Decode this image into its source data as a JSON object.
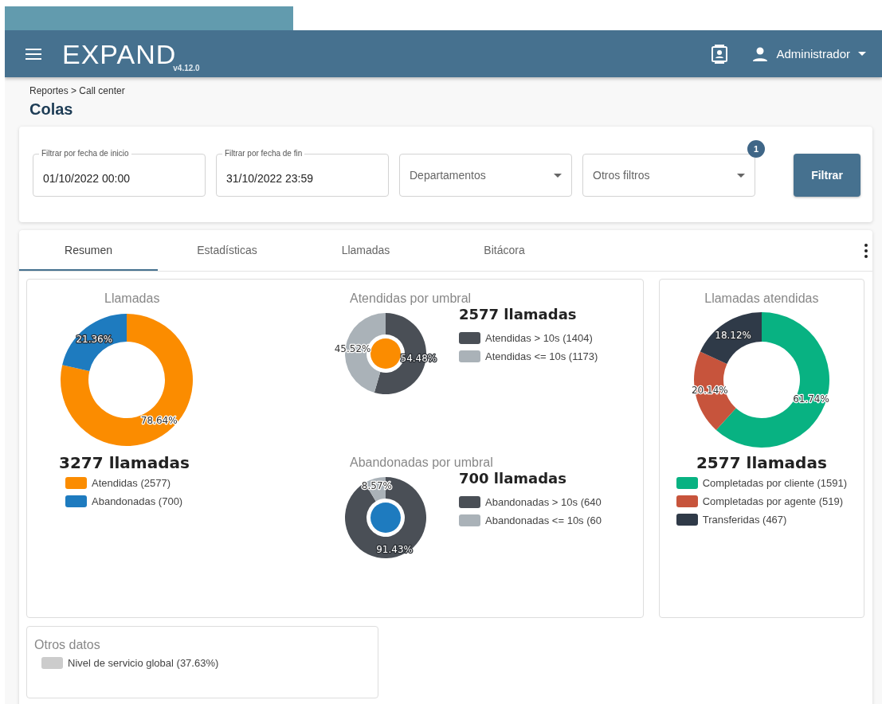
{
  "header": {
    "logo": "EXPAND",
    "version": "v4.12.0",
    "user": "Administrador"
  },
  "breadcrumb": "Reportes > Call center",
  "title": "Colas",
  "filters": [
    {
      "kind": "date",
      "label": "Filtrar por fecha de inicio",
      "value": "01/10/2022 00:00"
    },
    {
      "kind": "date",
      "label": "Filtrar por fecha de fin",
      "value": "31/10/2022 23:59"
    },
    {
      "kind": "select",
      "placeholder": "Departamentos"
    },
    {
      "kind": "select",
      "placeholder": "Otros filtros",
      "badge": "1"
    }
  ],
  "filter_button": "Filtrar",
  "tabs": [
    {
      "label": "Resumen",
      "selected": true
    },
    {
      "label": "Estadísticas",
      "selected": false
    },
    {
      "label": "Llamadas",
      "selected": false
    },
    {
      "label": "Bitácora",
      "selected": false
    }
  ],
  "llamadas": {
    "total": "3277 llamadas",
    "legend": [
      {
        "color": "#fb8c00"
      },
      {
        "color": "#1e7bbf"
      }
    ],
    "chart_data": {
      "type": "donut",
      "title": "Llamadas",
      "categories": [
        "Atendidas (2577)",
        "Abandonadas (700)"
      ],
      "values": [
        78.64,
        21.36
      ],
      "value_labels": [
        "78.64%",
        "21.36%"
      ]
    }
  },
  "thresholds": [
    {
      "total": "2577 llamadas",
      "color": "#fb8c00",
      "legend": [
        {
          "color": "#4a4f56"
        },
        {
          "color": "#aab2b8"
        }
      ],
      "chart_data": {
        "type": "donut",
        "title": "Atendidas por umbral",
        "categories": [
          "Atendidas > 10s (1404)",
          "Atendidas <= 10s (1173)"
        ],
        "values": [
          54.48,
          45.52
        ],
        "value_labels": [
          "54.48%",
          "45.52%"
        ]
      }
    },
    {
      "total": "700 llamadas",
      "color": "#1e7bbf",
      "legend": [
        {
          "color": "#4a4f56"
        },
        {
          "color": "#aab2b8"
        }
      ],
      "chart_data": {
        "type": "donut",
        "title": "Abandonadas por umbral",
        "categories": [
          "Abandonadas > 10s (640",
          "Abandonadas <= 10s (60"
        ],
        "values": [
          91.43,
          8.57
        ],
        "value_labels": [
          "91.43%",
          "8.57%"
        ]
      }
    }
  ],
  "atendidas": {
    "total": "2577 llamadas",
    "legend": [
      {
        "color": "#08b282"
      },
      {
        "color": "#c7543c"
      },
      {
        "color": "#2f3a48"
      }
    ],
    "chart_data": {
      "type": "donut",
      "title": "Llamadas atendidas",
      "categories": [
        "Completadas por cliente (1591)",
        "Completadas por agente (519)",
        "Transferidas (467)"
      ],
      "values": [
        61.74,
        20.14,
        18.12
      ],
      "value_labels": [
        "61.74%",
        "20.14%",
        "18.12%"
      ]
    }
  },
  "otros": {
    "title": "Otros datos",
    "legend": [
      {
        "label": "Nivel de servicio global (37.63%)",
        "color": "#cccccc"
      }
    ]
  }
}
